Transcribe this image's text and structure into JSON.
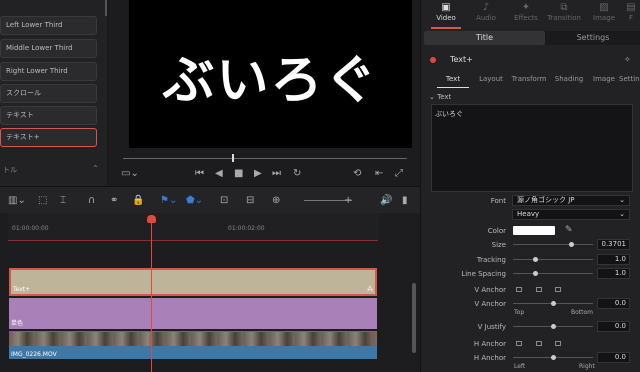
{
  "effects": {
    "items": [
      {
        "label": "Left Lower Third"
      },
      {
        "label": "Middle Lower Third"
      },
      {
        "label": "Right Lower Third"
      },
      {
        "label": "スクロール"
      },
      {
        "label": "テキスト"
      },
      {
        "label": "テキスト+"
      }
    ],
    "section_label": "トル"
  },
  "viewer": {
    "preview_text": "ぶいろぐ"
  },
  "inspector": {
    "top_tabs": [
      "Video",
      "Audio",
      "Effects",
      "Transition",
      "Image",
      "F"
    ],
    "sub_tabs": [
      "Title",
      "Settings"
    ],
    "title_name": "Text+",
    "text_tabs": [
      "Text",
      "Layout",
      "Transform",
      "Shading",
      "Image",
      "Setting"
    ],
    "section_text": "Text",
    "text_content": "ぶいろぐ",
    "font_label": "Font",
    "font_value": "源ノ角ゴシック JP",
    "weight_value": "Heavy",
    "color_label": "Color",
    "size_label": "Size",
    "size_value": "0.3701",
    "tracking_label": "Tracking",
    "tracking_value": "1.0",
    "line_spacing_label": "Line Spacing",
    "line_spacing_value": "1.0",
    "v_anchor_label": "V Anchor",
    "v_anchor_value": "0.0",
    "v_top": "Top",
    "v_bottom": "Bottom",
    "v_justify_label": "V Justify",
    "v_justify_value": "0.0",
    "h_anchor_label": "H Anchor",
    "h_anchor_value": "0.0",
    "h_left": "Left",
    "h_right": "Right"
  },
  "timeline": {
    "tc_start": "01:00:00:00",
    "tc_mid": "01:00:02:00",
    "clips": {
      "text_clip": "Text+",
      "purple_clip": "単色",
      "video_clip": "IMG_0226.MOV"
    }
  },
  "colors": {
    "accent": "#d8574a",
    "text_clip": "#bdb49a",
    "purple_clip": "#a981b8",
    "video_clip": "#3d79a8"
  }
}
